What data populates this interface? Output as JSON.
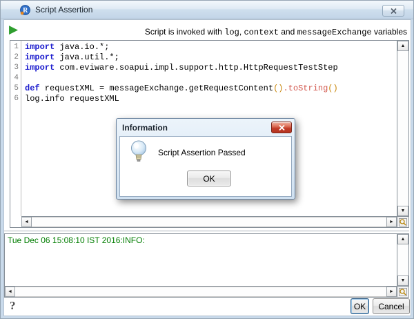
{
  "window": {
    "title": "Script Assertion"
  },
  "icons": {
    "play": "▶",
    "scroll_up": "▲",
    "scroll_down": "▼",
    "scroll_left": "◄",
    "scroll_right": "►",
    "help": "?",
    "close": "x-cross",
    "magnifier": "magnifying-glass",
    "bulb": "light-bulb",
    "logo": "soapui-logo"
  },
  "toolbar": {
    "desc": [
      "Script is invoked with ",
      "log",
      ", ",
      "context",
      " and ",
      "messageExchange",
      " variables"
    ]
  },
  "editor": {
    "lines": [
      {
        "number": "1",
        "segments": [
          {
            "t": "import",
            "s": "kw"
          },
          {
            "t": " java.io.*;",
            "s": "plain"
          }
        ]
      },
      {
        "number": "2",
        "segments": [
          {
            "t": "import",
            "s": "kw"
          },
          {
            "t": " java.util.*;",
            "s": "plain"
          }
        ]
      },
      {
        "number": "3",
        "segments": [
          {
            "t": "import",
            "s": "kw"
          },
          {
            "t": " com.eviware.soapui.impl.support.http.HttpRequestTestStep",
            "s": "plain"
          }
        ]
      },
      {
        "number": "4",
        "segments": []
      },
      {
        "number": "5",
        "segments": [
          {
            "t": "def",
            "s": "kw"
          },
          {
            "t": " requestXML = messageExchange.getRequestContent",
            "s": "plain"
          },
          {
            "t": "()",
            "s": "paren"
          },
          {
            "t": ".toString",
            "s": "func"
          },
          {
            "t": "()",
            "s": "paren"
          }
        ]
      },
      {
        "number": "6",
        "segments": [
          {
            "t": "log.info requestXML",
            "s": "plain"
          }
        ]
      }
    ]
  },
  "info_dialog": {
    "title": "Information",
    "message": "Script Assertion Passed",
    "ok": "OK"
  },
  "log": {
    "entry": "Tue Dec 06 15:08:10 IST 2016:INFO:"
  },
  "footer": {
    "help": "?",
    "ok": "OK",
    "cancel": "Cancel"
  },
  "colors": {
    "keyword_blue": "#1a1acd",
    "paren_orange": "#c8860a",
    "method_red": "#d2574d",
    "line_number_gray": "#7a7a7a",
    "log_green": "#007d00",
    "play_green": "#2f9e2f",
    "dialog_close_red": "#c13b28",
    "titlebar_blue": "#c2d4e7"
  }
}
